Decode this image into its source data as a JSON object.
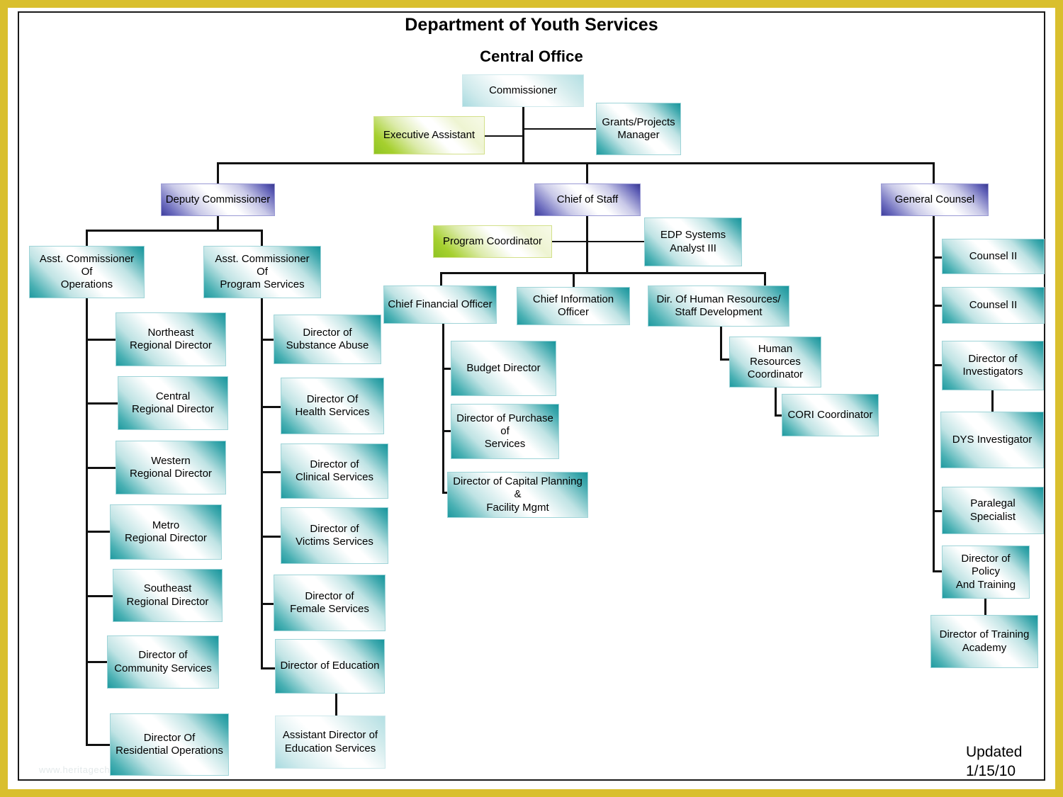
{
  "page": {
    "title_main": "Department of Youth Services",
    "title_sub": "Central Office",
    "updated_label": "Updated",
    "updated_date": "1/15/10",
    "watermark": "www.heritagechristiancollege.com",
    "border_color": "#d9bf2e",
    "frame_color": "#1a1a1a"
  },
  "colors": {
    "teal_dark": "#17959c",
    "teal_light": "#a9dbe0",
    "purple_dark": "#39398f",
    "green_accent": "#8fc423",
    "connector": "#111111"
  },
  "chart_data": {
    "type": "diagram",
    "title": "Department of Youth Services Central Office",
    "nodes": [
      {
        "id": "commissioner",
        "label": "Commissioner",
        "style": "teal-light",
        "level": 1
      },
      {
        "id": "executive-assistant",
        "label": "Executive Assistant",
        "style": "green",
        "level": 2
      },
      {
        "id": "grants-projects-manager",
        "label": "Grants/Projects\nManager",
        "style": "teal",
        "level": 2
      },
      {
        "id": "deputy-commissioner",
        "label": "Deputy Commissioner",
        "style": "purple",
        "level": 3
      },
      {
        "id": "chief-of-staff",
        "label": "Chief of Staff",
        "style": "purple",
        "level": 3
      },
      {
        "id": "general-counsel",
        "label": "General Counsel",
        "style": "purple",
        "level": 3
      },
      {
        "id": "asst-commissioner-operations",
        "label": "Asst. Commissioner\nOf\nOperations",
        "style": "teal",
        "level": 4
      },
      {
        "id": "asst-commissioner-program-services",
        "label": "Asst.  Commissioner\nOf\nProgram Services",
        "style": "teal",
        "level": 4
      },
      {
        "id": "program-coordinator",
        "label": "Program Coordinator",
        "style": "green",
        "level": 4
      },
      {
        "id": "edp-systems-analyst-iii",
        "label": "EDP Systems\nAnalyst III",
        "style": "teal",
        "level": 4
      },
      {
        "id": "northeast-regional-director",
        "label": "Northeast\nRegional Director",
        "style": "teal",
        "level": 5
      },
      {
        "id": "central-regional-director",
        "label": "Central\nRegional Director",
        "style": "teal",
        "level": 5
      },
      {
        "id": "western-regional-director",
        "label": "Western\nRegional Director",
        "style": "teal",
        "level": 5
      },
      {
        "id": "metro-regional-director",
        "label": "Metro\nRegional Director",
        "style": "teal",
        "level": 5
      },
      {
        "id": "southeast-regional-director",
        "label": "Southeast\nRegional Director",
        "style": "teal",
        "level": 5
      },
      {
        "id": "director-community-services",
        "label": "Director of\nCommunity Services",
        "style": "teal",
        "level": 5
      },
      {
        "id": "director-residential-operations",
        "label": "Director Of\nResidential Operations",
        "style": "teal",
        "level": 5
      },
      {
        "id": "director-substance-abuse",
        "label": "Director of\nSubstance Abuse",
        "style": "teal",
        "level": 5
      },
      {
        "id": "director-health-services",
        "label": "Director Of\nHealth Services",
        "style": "teal",
        "level": 5
      },
      {
        "id": "director-clinical-services",
        "label": "Director of\nClinical Services",
        "style": "teal",
        "level": 5
      },
      {
        "id": "director-victims-services",
        "label": "Director of\nVictims Services",
        "style": "teal",
        "level": 5
      },
      {
        "id": "director-female-services",
        "label": "Director of\nFemale Services",
        "style": "teal",
        "level": 5
      },
      {
        "id": "director-education",
        "label": "Director of Education",
        "style": "teal",
        "level": 5
      },
      {
        "id": "assistant-director-education-services",
        "label": "Assistant Director of\nEducation Services",
        "style": "teal-light",
        "level": 6
      },
      {
        "id": "chief-financial-officer",
        "label": "Chief Financial Officer",
        "style": "teal",
        "level": 5
      },
      {
        "id": "chief-information-officer",
        "label": "Chief Information Officer",
        "style": "teal",
        "level": 5
      },
      {
        "id": "dir-human-resources",
        "label": "Dir. Of Human Resources/\nStaff Development",
        "style": "teal",
        "level": 5
      },
      {
        "id": "budget-director",
        "label": "Budget Director",
        "style": "teal",
        "level": 6
      },
      {
        "id": "director-purchase-services",
        "label": "Director of Purchase of\nServices",
        "style": "teal",
        "level": 6
      },
      {
        "id": "director-capital-planning",
        "label": "Director of Capital Planning &\nFacility Mgmt",
        "style": "teal",
        "level": 6
      },
      {
        "id": "human-resources-coordinator",
        "label": "Human Resources\nCoordinator",
        "style": "teal",
        "level": 6
      },
      {
        "id": "cori-coordinator",
        "label": "CORI Coordinator",
        "style": "teal",
        "level": 7
      },
      {
        "id": "counsel-ii-1",
        "label": "Counsel II",
        "style": "teal",
        "level": 4
      },
      {
        "id": "counsel-ii-2",
        "label": "Counsel II",
        "style": "teal",
        "level": 4
      },
      {
        "id": "director-investigators",
        "label": "Director of\nInvestigators",
        "style": "teal",
        "level": 4
      },
      {
        "id": "dys-investigator",
        "label": "DYS Investigator",
        "style": "teal",
        "level": 5
      },
      {
        "id": "paralegal-specialist",
        "label": "Paralegal\nSpecialist",
        "style": "teal",
        "level": 4
      },
      {
        "id": "director-policy-training",
        "label": "Director of Policy\nAnd Training",
        "style": "teal",
        "level": 4
      },
      {
        "id": "director-training-academy",
        "label": "Director of Training\nAcademy",
        "style": "teal",
        "level": 5
      }
    ],
    "edges": [
      [
        "commissioner",
        "executive-assistant"
      ],
      [
        "commissioner",
        "grants-projects-manager"
      ],
      [
        "commissioner",
        "deputy-commissioner"
      ],
      [
        "commissioner",
        "chief-of-staff"
      ],
      [
        "commissioner",
        "general-counsel"
      ],
      [
        "deputy-commissioner",
        "asst-commissioner-operations"
      ],
      [
        "deputy-commissioner",
        "asst-commissioner-program-services"
      ],
      [
        "chief-of-staff",
        "program-coordinator"
      ],
      [
        "chief-of-staff",
        "edp-systems-analyst-iii"
      ],
      [
        "chief-of-staff",
        "chief-financial-officer"
      ],
      [
        "chief-of-staff",
        "chief-information-officer"
      ],
      [
        "chief-of-staff",
        "dir-human-resources"
      ],
      [
        "asst-commissioner-operations",
        "northeast-regional-director"
      ],
      [
        "asst-commissioner-operations",
        "central-regional-director"
      ],
      [
        "asst-commissioner-operations",
        "western-regional-director"
      ],
      [
        "asst-commissioner-operations",
        "metro-regional-director"
      ],
      [
        "asst-commissioner-operations",
        "southeast-regional-director"
      ],
      [
        "asst-commissioner-operations",
        "director-community-services"
      ],
      [
        "asst-commissioner-operations",
        "director-residential-operations"
      ],
      [
        "asst-commissioner-program-services",
        "director-substance-abuse"
      ],
      [
        "asst-commissioner-program-services",
        "director-health-services"
      ],
      [
        "asst-commissioner-program-services",
        "director-clinical-services"
      ],
      [
        "asst-commissioner-program-services",
        "director-victims-services"
      ],
      [
        "asst-commissioner-program-services",
        "director-female-services"
      ],
      [
        "asst-commissioner-program-services",
        "director-education"
      ],
      [
        "director-education",
        "assistant-director-education-services"
      ],
      [
        "chief-financial-officer",
        "budget-director"
      ],
      [
        "chief-financial-officer",
        "director-purchase-services"
      ],
      [
        "chief-financial-officer",
        "director-capital-planning"
      ],
      [
        "dir-human-resources",
        "human-resources-coordinator"
      ],
      [
        "human-resources-coordinator",
        "cori-coordinator"
      ],
      [
        "general-counsel",
        "counsel-ii-1"
      ],
      [
        "general-counsel",
        "counsel-ii-2"
      ],
      [
        "general-counsel",
        "director-investigators"
      ],
      [
        "director-investigators",
        "dys-investigator"
      ],
      [
        "general-counsel",
        "paralegal-specialist"
      ],
      [
        "general-counsel",
        "director-policy-training"
      ],
      [
        "director-policy-training",
        "director-training-academy"
      ]
    ]
  }
}
